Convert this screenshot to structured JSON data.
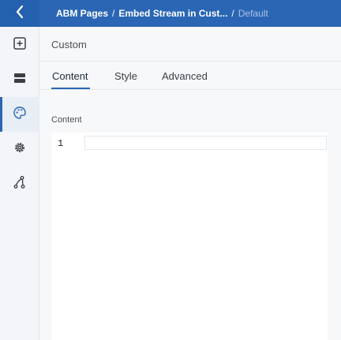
{
  "breadcrumb": {
    "items": [
      "ABM Pages",
      "Embed Stream in Cust..."
    ],
    "separator": "/",
    "current": "Default"
  },
  "nav": {
    "items": [
      {
        "icon": "add-square-icon"
      },
      {
        "icon": "layout-sections-icon"
      },
      {
        "icon": "palette-icon",
        "active": true
      },
      {
        "icon": "gear-icon"
      },
      {
        "icon": "integration-nodes-icon"
      }
    ]
  },
  "panel": {
    "title": "Custom",
    "tabs": [
      {
        "label": "Content",
        "active": true
      },
      {
        "label": "Style"
      },
      {
        "label": "Advanced"
      }
    ],
    "field_label": "Content",
    "editor": {
      "line_numbers": [
        "1"
      ],
      "value": ""
    }
  },
  "colors": {
    "accent": "#2a66b4",
    "sidebar": "#f3f5f8"
  }
}
